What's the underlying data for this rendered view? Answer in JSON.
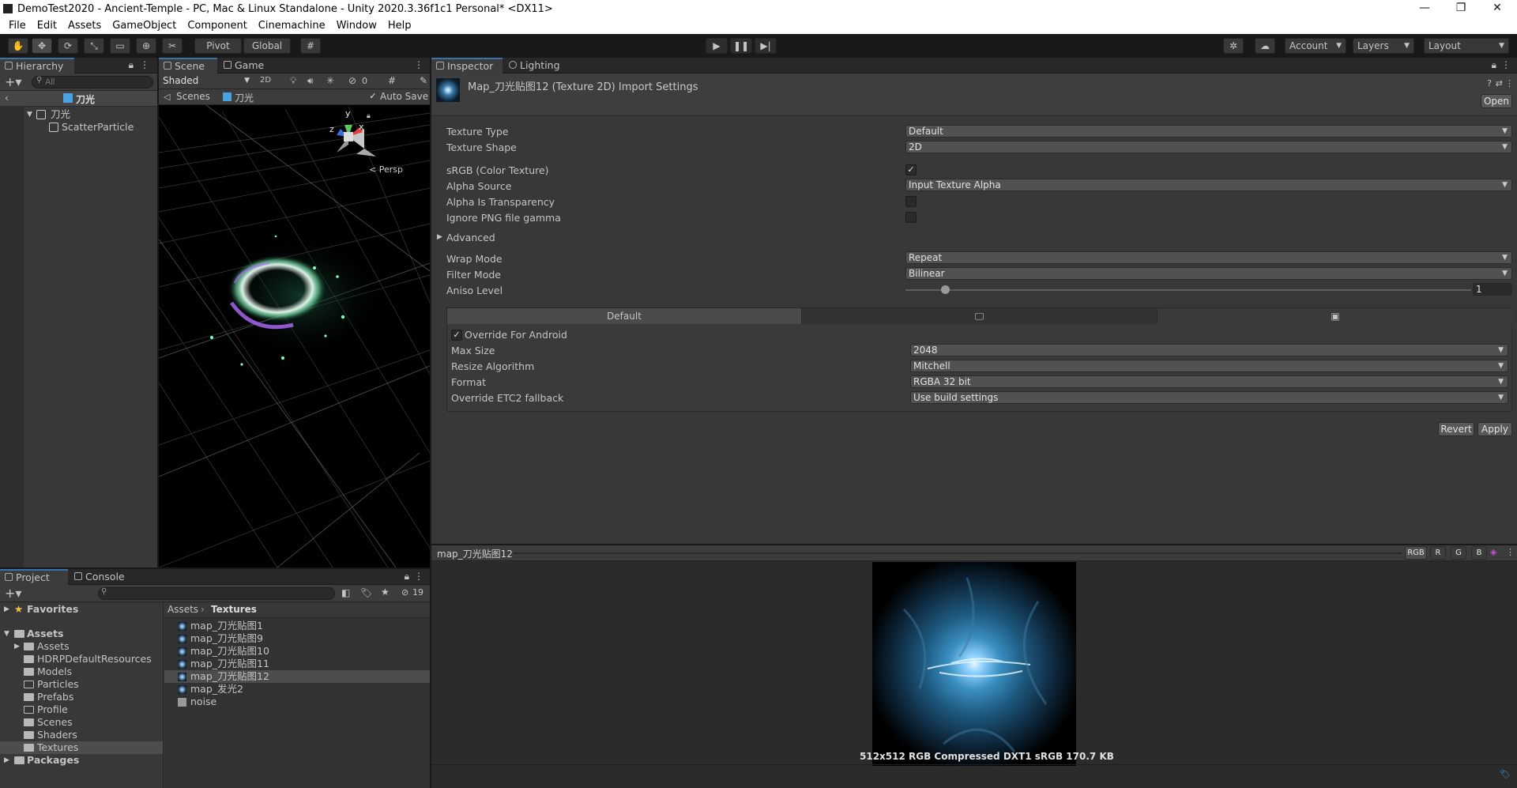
{
  "window": {
    "title": "DemoTest2020 - Ancient-Temple - PC, Mac & Linux Standalone - Unity 2020.3.36f1c1 Personal* <DX11>",
    "minimize": "—",
    "maximize": "❐",
    "close": "✕"
  },
  "menu": [
    "File",
    "Edit",
    "Assets",
    "GameObject",
    "Component",
    "Cinemachine",
    "Window",
    "Help"
  ],
  "toolbar": {
    "pivot": "Pivot",
    "global": "Global",
    "account": "Account",
    "layers": "Layers",
    "layout": "Layout"
  },
  "hierarchy": {
    "tab": "Hierarchy",
    "search_placeholder": "All",
    "scene_name": "刀光",
    "items": [
      {
        "label": "刀光"
      },
      {
        "label": "ScatterParticle"
      }
    ]
  },
  "scene": {
    "tab_scene": "Scene",
    "tab_game": "Game",
    "shading": "Shaded",
    "mode_2d": "2D",
    "hidden_count": "0",
    "breadcrumb_scenes": "Scenes",
    "breadcrumb_prefab": "刀光",
    "auto_save": "Auto Save",
    "persp": "< Persp",
    "gizmo": {
      "y": "y",
      "x": "x",
      "z": "z"
    }
  },
  "inspector": {
    "tab_inspector": "Inspector",
    "tab_lighting": "Lighting",
    "title": "Map_刀光贴图12 (Texture 2D) Import Settings",
    "open_button": "Open",
    "fields": {
      "texture_type": {
        "label": "Texture Type",
        "value": "Default"
      },
      "texture_shape": {
        "label": "Texture Shape",
        "value": "2D"
      },
      "srgb": {
        "label": "sRGB (Color Texture)",
        "checked": true
      },
      "alpha_source": {
        "label": "Alpha Source",
        "value": "Input Texture Alpha"
      },
      "alpha_transparency": {
        "label": "Alpha Is Transparency",
        "checked": false
      },
      "ignore_png": {
        "label": "Ignore PNG file gamma",
        "checked": false
      },
      "advanced": {
        "label": "Advanced"
      },
      "wrap_mode": {
        "label": "Wrap Mode",
        "value": "Repeat"
      },
      "filter_mode": {
        "label": "Filter Mode",
        "value": "Bilinear"
      },
      "aniso_level": {
        "label": "Aniso Level",
        "value": "1"
      }
    },
    "platform_tabs": {
      "default": "Default"
    },
    "android": {
      "override": {
        "label": "Override For Android",
        "checked": true
      },
      "max_size": {
        "label": "Max Size",
        "value": "2048"
      },
      "resize_algorithm": {
        "label": "Resize Algorithm",
        "value": "Mitchell"
      },
      "format": {
        "label": "Format",
        "value": "RGBA 32 bit"
      },
      "etc2_fallback": {
        "label": "Override ETC2 fallback",
        "value": "Use build settings"
      }
    },
    "revert_button": "Revert",
    "apply_button": "Apply"
  },
  "preview": {
    "name": "map_刀光贴图12",
    "channels": [
      "RGB",
      "R",
      "G",
      "B"
    ],
    "info": "512x512  RGB Compressed DXT1 sRGB  170.7 KB"
  },
  "project": {
    "tab_project": "Project",
    "tab_console": "Console",
    "hidden_count": "19",
    "favorites": "Favorites",
    "assets_root": "Assets",
    "folders": [
      "Assets",
      "HDRPDefaultResources",
      "Models",
      "Particles",
      "Prefabs",
      "Profile",
      "Scenes",
      "Shaders",
      "Textures"
    ],
    "packages": "Packages",
    "breadcrumb": [
      "Assets",
      "Textures"
    ],
    "files": [
      "map_刀光贴图1",
      "map_刀光贴图9",
      "map_刀光贴图10",
      "map_刀光贴图11",
      "map_刀光贴图12",
      "map_发光2",
      "noise"
    ]
  },
  "colors": {
    "accent": "#3a72b0",
    "selection": "#4d4d4d",
    "panel": "#383838",
    "background": "#191919"
  }
}
